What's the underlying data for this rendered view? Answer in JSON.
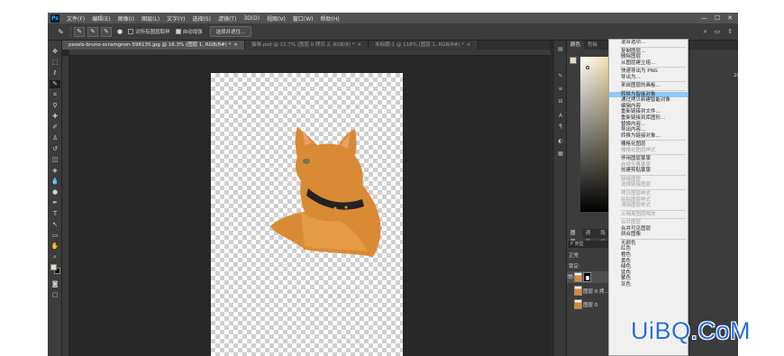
{
  "app": {
    "logo": "Ps"
  },
  "menubar": {
    "items": [
      "文件(F)",
      "编辑(E)",
      "图像(I)",
      "图层(L)",
      "文字(Y)",
      "选择(S)",
      "滤镜(T)",
      "3D(D)",
      "视图(V)",
      "窗口(W)",
      "帮助(H)"
    ],
    "window_controls": [
      "—",
      "☐",
      "✕"
    ]
  },
  "options_bar": {
    "auto_select_label": "对所有图层取样",
    "auto_enhance_label": "自动增强",
    "select_subject_label": "选择并遮住..."
  },
  "tabs": [
    {
      "label": "pexels-bruno-scramgnon-596135.jpg @ 16.3% (图层 1, RGB/8#) *",
      "active": true
    },
    {
      "label": "猫咪.psd @ 12.7% (图层 0 拷贝 2, RGB/8) *",
      "active": false
    },
    {
      "label": "未标题-1 @ 118% (图层 1, RGB/8#) *",
      "active": false
    }
  ],
  "right_panel": {
    "color_tabs": [
      "颜色",
      "色板"
    ],
    "layers_tabs": [
      "图层",
      "通道",
      "路径"
    ],
    "search_label": "P 类型",
    "blend_mode": "正常",
    "lock_label": "锁定:",
    "layers": [
      {
        "name": "",
        "selected": true,
        "visible": true
      },
      {
        "name": "图层 0 拷...",
        "selected": false,
        "visible": false
      },
      {
        "name": "图层 0",
        "selected": false,
        "visible": false
      }
    ],
    "partial_text": "28"
  },
  "context_menu": {
    "items": [
      {
        "label": "混合选项...",
        "state": "normal"
      },
      {
        "sep": true
      },
      {
        "label": "复制图层...",
        "state": "normal"
      },
      {
        "label": "删除图层",
        "state": "normal"
      },
      {
        "label": "从图层建立组...",
        "state": "normal"
      },
      {
        "sep": true
      },
      {
        "label": "快速导出为 PNG",
        "state": "normal"
      },
      {
        "label": "导出为...",
        "state": "normal"
      },
      {
        "sep": true
      },
      {
        "label": "来自图层的画板...",
        "state": "normal"
      },
      {
        "sep": true
      },
      {
        "label": "转换为智能对象",
        "state": "hl"
      },
      {
        "label": "通过拷贝新建智能对象",
        "state": "normal"
      },
      {
        "label": "编辑内容",
        "state": "normal"
      },
      {
        "label": "重新链接到文件...",
        "state": "normal"
      },
      {
        "label": "重新链接到库图形...",
        "state": "normal"
      },
      {
        "label": "替换内容...",
        "state": "normal"
      },
      {
        "label": "导出内容...",
        "state": "normal"
      },
      {
        "label": "转换为链接对象...",
        "state": "normal"
      },
      {
        "sep": true
      },
      {
        "label": "栅格化图层",
        "state": "normal"
      },
      {
        "label": "栅格化图层样式",
        "state": "dis"
      },
      {
        "sep": true
      },
      {
        "label": "停用图层蒙版",
        "state": "normal"
      },
      {
        "label": "启用矢量蒙版",
        "state": "dis"
      },
      {
        "label": "创建剪贴蒙版",
        "state": "normal"
      },
      {
        "sep": true
      },
      {
        "label": "链接图层",
        "state": "dis"
      },
      {
        "label": "选择链接图层",
        "state": "dis"
      },
      {
        "sep": true
      },
      {
        "label": "拷贝图层样式",
        "state": "dis"
      },
      {
        "label": "粘贴图层样式",
        "state": "dis"
      },
      {
        "label": "清除图层样式",
        "state": "dis"
      },
      {
        "sep": true
      },
      {
        "label": "从隔离图层释放",
        "state": "dis"
      },
      {
        "sep": true
      },
      {
        "label": "合并图层",
        "state": "dis"
      },
      {
        "label": "合并可见图层",
        "state": "normal"
      },
      {
        "label": "拼合图像",
        "state": "normal"
      },
      {
        "sep": true
      },
      {
        "label": "无颜色",
        "state": "normal"
      },
      {
        "label": "红色",
        "state": "normal"
      },
      {
        "label": "橙色",
        "state": "normal"
      },
      {
        "label": "黄色",
        "state": "normal"
      },
      {
        "label": "绿色",
        "state": "normal"
      },
      {
        "label": "蓝色",
        "state": "normal"
      },
      {
        "label": "紫色",
        "state": "normal"
      },
      {
        "label": "灰色",
        "state": "normal"
      }
    ]
  },
  "watermark": {
    "text": "UiBQ.CoM"
  },
  "colors": {
    "highlight": "#91c9f7",
    "watermark": "#2a6edc",
    "foreground": "#e8dcc0",
    "cat": "#d98a34"
  }
}
